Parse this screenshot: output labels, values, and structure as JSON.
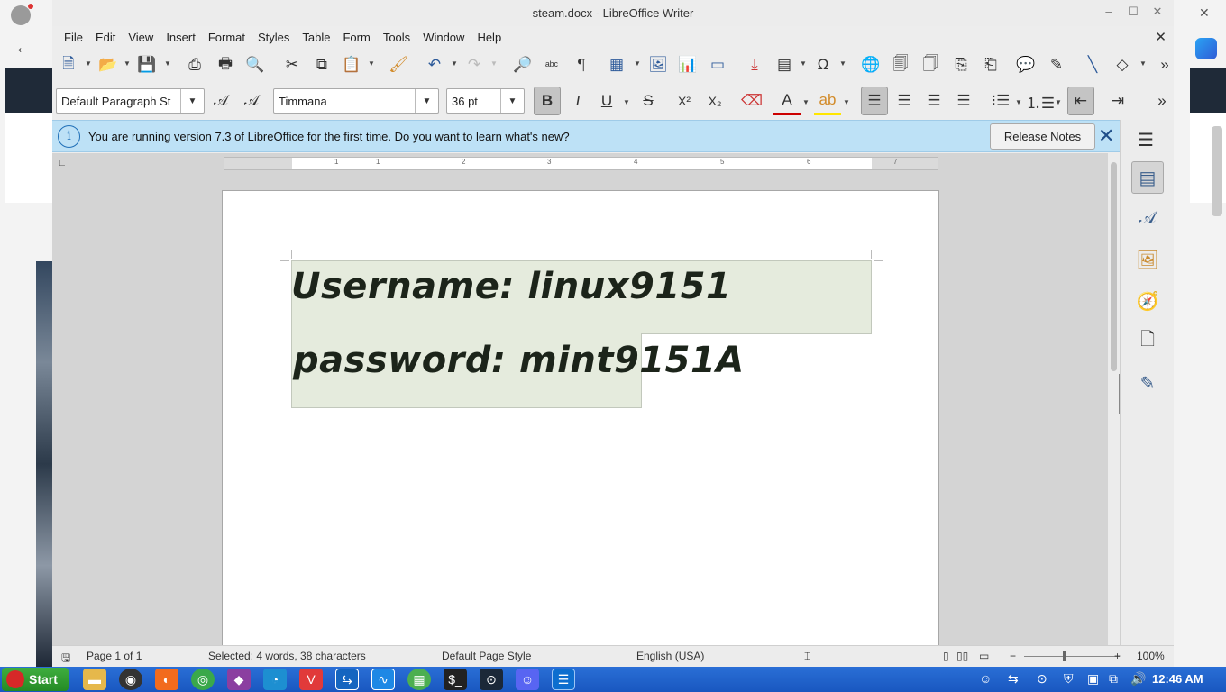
{
  "window": {
    "title": "steam.docx - LibreOffice Writer"
  },
  "menubar": [
    "File",
    "Edit",
    "View",
    "Insert",
    "Format",
    "Styles",
    "Table",
    "Form",
    "Tools",
    "Window",
    "Help"
  ],
  "formatting": {
    "paragraph_style": "Default Paragraph St",
    "font_name": "Timmana",
    "font_size": "36 pt"
  },
  "infobar": {
    "message": "You are running version 7.3 of LibreOffice for the first time. Do you want to learn what's new?",
    "button": "Release Notes"
  },
  "document": {
    "line1": "Username:  linux9151",
    "line2": "password:  mint9151A"
  },
  "ruler_numbers": [
    "1",
    "1",
    "2",
    "3",
    "4",
    "5",
    "6",
    "7"
  ],
  "statusbar": {
    "page": "Page 1 of 1",
    "selection": "Selected: 4 words, 38 characters",
    "page_style": "Default Page Style",
    "language": "English (USA)",
    "zoom": "100%"
  },
  "taskbar": {
    "start_label": "Start",
    "clock": "12:46 AM"
  },
  "colors": {
    "infobar_bg": "#bde1f6",
    "selection_highlight": "#e5ebdd",
    "taskbar": "#1f62cc",
    "start_button": "#2f9e2f"
  }
}
